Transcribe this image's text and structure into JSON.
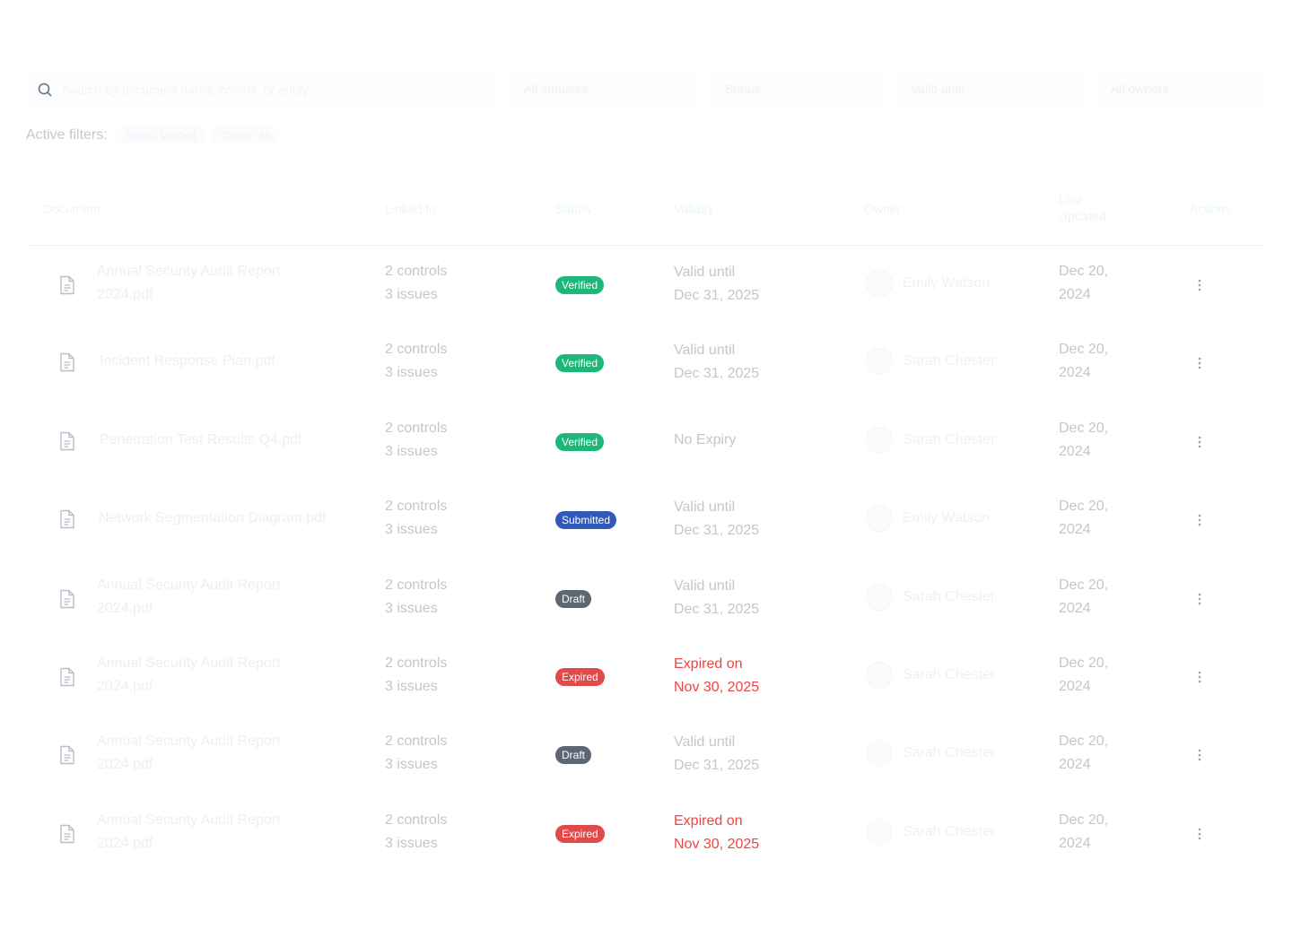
{
  "search": {
    "placeholder": "Search by document name, control, or entity"
  },
  "filters": [
    "All statuses",
    "Status",
    "Valid until",
    "All owners"
  ],
  "active_filters": {
    "label": "Active filters:",
    "chips": [
      "Status: Verified",
      "Owner: All"
    ]
  },
  "table": {
    "columns": [
      "Document",
      "Linked to",
      "Status",
      "Validity",
      "Owner",
      "Last Updated",
      "Actions"
    ],
    "rows": [
      {
        "name": "Annual Security Audit Report 2024.pdf",
        "controls": "2 controls",
        "issues": "3 issues",
        "status": "Verified",
        "validity_1": "Valid until",
        "validity_2": "Dec 31, 2025",
        "owner": "Emily Watson",
        "date_1": "Dec 20,",
        "date_2": "2024"
      },
      {
        "name": "Incident Response Plan.pdf",
        "controls": "2 controls",
        "issues": "3 issues",
        "status": "Verified",
        "validity_1": "Valid until",
        "validity_2": "Dec 31, 2025",
        "owner": "Sarah Chester",
        "date_1": "Dec 20,",
        "date_2": "2024"
      },
      {
        "name": "Penetration Test Results Q4.pdf",
        "controls": "2 controls",
        "issues": "3 issues",
        "status": "Verified",
        "validity_1": "No Expiry",
        "validity_2": "",
        "owner": "Sarah Chester",
        "date_1": "Dec 20,",
        "date_2": "2024"
      },
      {
        "name": "Network Segmentation Diagram.pdf",
        "controls": "2 controls",
        "issues": "3 issues",
        "status": "Submitted",
        "validity_1": "Valid until",
        "validity_2": "Dec 31, 2025",
        "owner": "Emily Watson",
        "date_1": "Dec 20,",
        "date_2": "2024"
      },
      {
        "name": "Annual Security Audit Report 2024.pdf",
        "controls": "2 controls",
        "issues": "3 issues",
        "status": "Draft",
        "validity_1": "Valid until",
        "validity_2": "Dec 31, 2025",
        "owner": "Sarah Chester",
        "date_1": "Dec 20,",
        "date_2": "2024"
      },
      {
        "name": "Annual Security Audit Report 2024.pdf",
        "controls": "2 controls",
        "issues": "3 issues",
        "status": "Expired",
        "validity_1": "Expired on",
        "validity_2": "Nov 30, 2025",
        "owner": "Sarah Chester",
        "date_1": "Dec 20,",
        "date_2": "2024"
      },
      {
        "name": "Annual Security Audit Report 2024.pdf",
        "controls": "2 controls",
        "issues": "3 issues",
        "status": "Draft",
        "validity_1": "Valid until",
        "validity_2": "Dec 31, 2025",
        "owner": "Sarah Chester",
        "date_1": "Dec 20,",
        "date_2": "2024"
      },
      {
        "name": "Annual Security Audit Report 2024.pdf",
        "controls": "2 controls",
        "issues": "3 issues",
        "status": "Expired",
        "validity_1": "Expired on",
        "validity_2": "Nov 30, 2025",
        "owner": "Sarah Chester",
        "date_1": "Dec 20,",
        "date_2": "2024"
      }
    ]
  },
  "colors": {
    "verified": "#1db879",
    "submitted": "#2f5ab8",
    "draft": "#5d6673",
    "expired": "#e14a4a",
    "expired_text": "#ee4444"
  }
}
